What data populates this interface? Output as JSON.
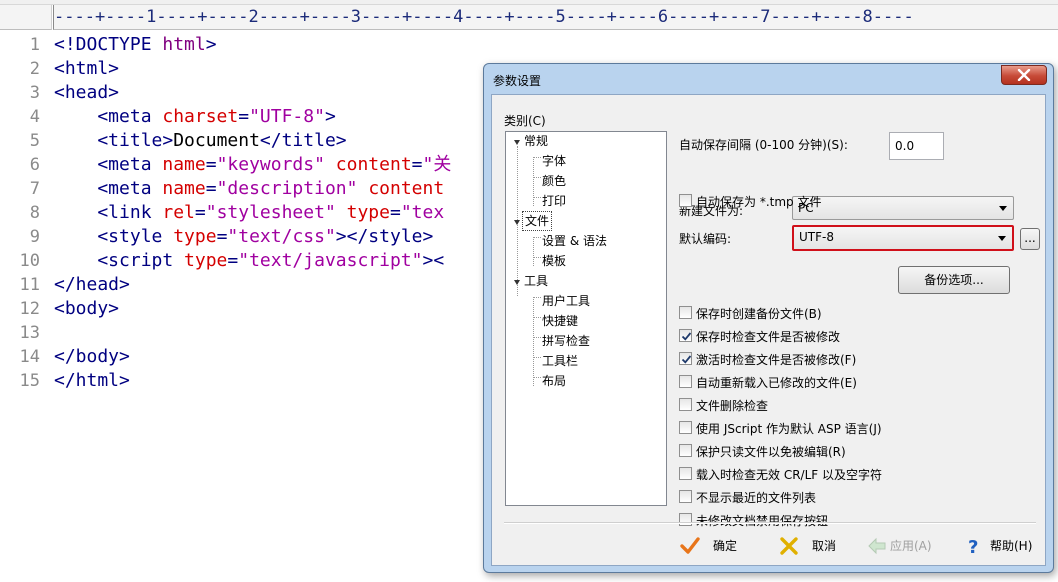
{
  "editor": {
    "ruler_text": "----+----1----+----2----+----3----+----4----+----5----+----6----+----7----+----8----",
    "line_numbers": [
      "1",
      "2",
      "3",
      "4",
      "5",
      "6",
      "7",
      "8",
      "9",
      "10",
      "11",
      "12",
      "13",
      "14",
      "15"
    ],
    "code_lines": [
      [
        {
          "t": "<!DOCTYPE ",
          "c": "#000080"
        },
        {
          "t": "html",
          "c": "#800080"
        },
        {
          "t": ">",
          "c": "#000080"
        }
      ],
      [
        {
          "t": "<html>",
          "c": "#000080"
        }
      ],
      [
        {
          "t": "<head>",
          "c": "#000080"
        }
      ],
      [
        {
          "t": "    <meta ",
          "c": "#000080"
        },
        {
          "t": "charset",
          "c": "#d40000"
        },
        {
          "t": "=",
          "c": "#000080"
        },
        {
          "t": "\"UTF-8\"",
          "c": "#a000a0"
        },
        {
          "t": ">",
          "c": "#000080"
        }
      ],
      [
        {
          "t": "    <title>",
          "c": "#000080"
        },
        {
          "t": "Document",
          "c": "#000000"
        },
        {
          "t": "</title>",
          "c": "#000080"
        }
      ],
      [
        {
          "t": "    <meta ",
          "c": "#000080"
        },
        {
          "t": "name",
          "c": "#d40000"
        },
        {
          "t": "=",
          "c": "#000080"
        },
        {
          "t": "\"keywords\"",
          "c": "#a000a0"
        },
        {
          "t": " ",
          "c": "#000080"
        },
        {
          "t": "content",
          "c": "#d40000"
        },
        {
          "t": "=",
          "c": "#000080"
        },
        {
          "t": "\"关",
          "c": "#a000a0"
        }
      ],
      [
        {
          "t": "    <meta ",
          "c": "#000080"
        },
        {
          "t": "name",
          "c": "#d40000"
        },
        {
          "t": "=",
          "c": "#000080"
        },
        {
          "t": "\"description\"",
          "c": "#a000a0"
        },
        {
          "t": " ",
          "c": "#000080"
        },
        {
          "t": "content",
          "c": "#d40000"
        }
      ],
      [
        {
          "t": "    <link ",
          "c": "#000080"
        },
        {
          "t": "rel",
          "c": "#d40000"
        },
        {
          "t": "=",
          "c": "#000080"
        },
        {
          "t": "\"stylesheet\"",
          "c": "#a000a0"
        },
        {
          "t": " ",
          "c": "#000080"
        },
        {
          "t": "type",
          "c": "#d40000"
        },
        {
          "t": "=",
          "c": "#000080"
        },
        {
          "t": "\"tex",
          "c": "#a000a0"
        }
      ],
      [
        {
          "t": "    <style ",
          "c": "#000080"
        },
        {
          "t": "type",
          "c": "#d40000"
        },
        {
          "t": "=",
          "c": "#000080"
        },
        {
          "t": "\"text/css\"",
          "c": "#a000a0"
        },
        {
          "t": "></style>",
          "c": "#000080"
        }
      ],
      [
        {
          "t": "    <script ",
          "c": "#000080"
        },
        {
          "t": "type",
          "c": "#d40000"
        },
        {
          "t": "=",
          "c": "#000080"
        },
        {
          "t": "\"text/javascript\"",
          "c": "#a000a0"
        },
        {
          "t": "><",
          "c": "#000080"
        }
      ],
      [
        {
          "t": "</head>",
          "c": "#000080"
        }
      ],
      [
        {
          "t": "<body>",
          "c": "#000080"
        }
      ],
      [],
      [
        {
          "t": "</body>",
          "c": "#000080"
        }
      ],
      [
        {
          "t": "</html>",
          "c": "#000080"
        }
      ]
    ]
  },
  "dialog": {
    "title": "参数设置",
    "category_label": "类别(C)",
    "tree": {
      "general": "常规",
      "font": "字体",
      "color": "颜色",
      "print": "打印",
      "file": "文件",
      "settings_syntax": "设置 & 语法",
      "template": "模板",
      "tools": "工具",
      "user_tools": "用户工具",
      "shortcuts": "快捷键",
      "spellcheck": "拼写检查",
      "toolbar": "工具栏",
      "layout": "布局"
    },
    "autosave_interval_label": "自动保存间隔 (0-100 分钟)(S):",
    "autosave_interval_value": "0.0",
    "newfile_label": "新建文件为:",
    "newfile_value": "PC",
    "encoding_label": "默认编码:",
    "encoding_value": "UTF-8",
    "ellipsis_button": "...",
    "backup_options_button": "备份选项...",
    "checkboxes": [
      {
        "label": "自动保存为 *.tmp 文件",
        "checked": false
      },
      {
        "label": "保存时创建备份文件(B)",
        "checked": false
      },
      {
        "label": "保存时检查文件是否被修改",
        "checked": true
      },
      {
        "label": "激活时检查文件是否被修改(F)",
        "checked": true
      },
      {
        "label": "自动重新载入已修改的文件(E)",
        "checked": false
      },
      {
        "label": "文件删除检查",
        "checked": false
      },
      {
        "label": "使用 JScript 作为默认 ASP 语言(J)",
        "checked": false
      },
      {
        "label": "保护只读文件以免被编辑(R)",
        "checked": false
      },
      {
        "label": "载入时检查无效 CR/LF 以及空字符",
        "checked": false
      },
      {
        "label": "不显示最近的文件列表",
        "checked": false
      },
      {
        "label": "未修改文档禁用保存按钮",
        "checked": false
      }
    ],
    "buttons": {
      "ok": "确定",
      "cancel": "取消",
      "apply": "应用(A)",
      "help": "帮助(H)"
    },
    "colors": {
      "frame": "#b9d3ee",
      "highlight_border": "#d0101a",
      "ok_check": "#e8751a",
      "cancel_x": "#e0b000",
      "help_q": "#2060c0"
    }
  }
}
